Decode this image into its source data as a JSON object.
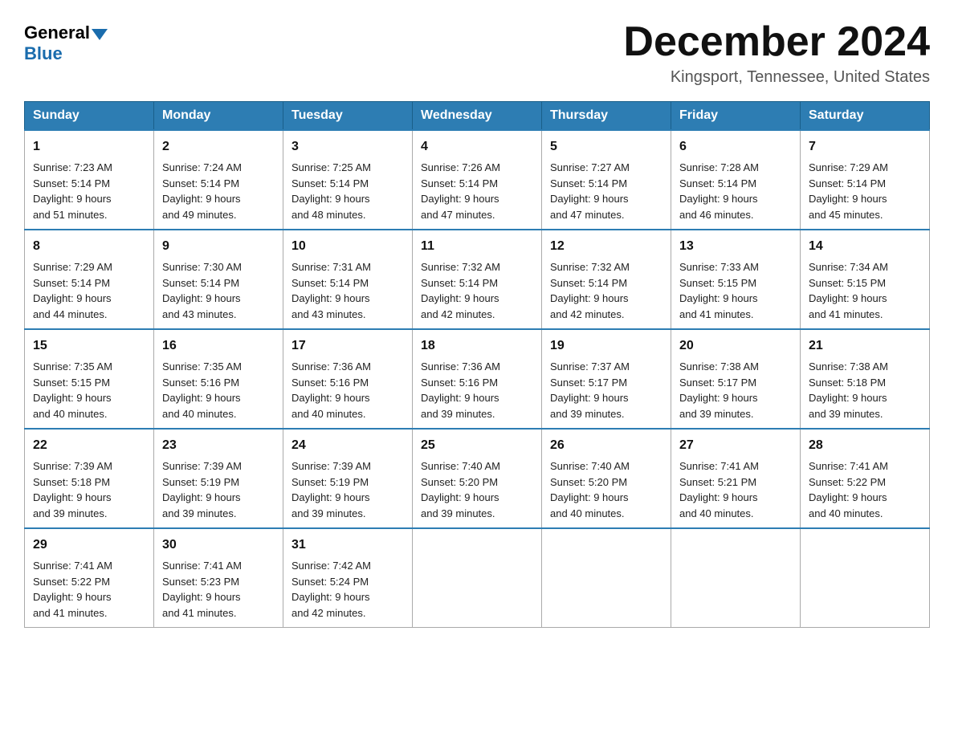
{
  "header": {
    "logo_general": "General",
    "logo_blue": "Blue",
    "month_title": "December 2024",
    "location": "Kingsport, Tennessee, United States"
  },
  "days_of_week": [
    "Sunday",
    "Monday",
    "Tuesday",
    "Wednesday",
    "Thursday",
    "Friday",
    "Saturday"
  ],
  "weeks": [
    [
      {
        "day": "1",
        "sunrise": "7:23 AM",
        "sunset": "5:14 PM",
        "daylight": "9 hours and 51 minutes."
      },
      {
        "day": "2",
        "sunrise": "7:24 AM",
        "sunset": "5:14 PM",
        "daylight": "9 hours and 49 minutes."
      },
      {
        "day": "3",
        "sunrise": "7:25 AM",
        "sunset": "5:14 PM",
        "daylight": "9 hours and 48 minutes."
      },
      {
        "day": "4",
        "sunrise": "7:26 AM",
        "sunset": "5:14 PM",
        "daylight": "9 hours and 47 minutes."
      },
      {
        "day": "5",
        "sunrise": "7:27 AM",
        "sunset": "5:14 PM",
        "daylight": "9 hours and 47 minutes."
      },
      {
        "day": "6",
        "sunrise": "7:28 AM",
        "sunset": "5:14 PM",
        "daylight": "9 hours and 46 minutes."
      },
      {
        "day": "7",
        "sunrise": "7:29 AM",
        "sunset": "5:14 PM",
        "daylight": "9 hours and 45 minutes."
      }
    ],
    [
      {
        "day": "8",
        "sunrise": "7:29 AM",
        "sunset": "5:14 PM",
        "daylight": "9 hours and 44 minutes."
      },
      {
        "day": "9",
        "sunrise": "7:30 AM",
        "sunset": "5:14 PM",
        "daylight": "9 hours and 43 minutes."
      },
      {
        "day": "10",
        "sunrise": "7:31 AM",
        "sunset": "5:14 PM",
        "daylight": "9 hours and 43 minutes."
      },
      {
        "day": "11",
        "sunrise": "7:32 AM",
        "sunset": "5:14 PM",
        "daylight": "9 hours and 42 minutes."
      },
      {
        "day": "12",
        "sunrise": "7:32 AM",
        "sunset": "5:14 PM",
        "daylight": "9 hours and 42 minutes."
      },
      {
        "day": "13",
        "sunrise": "7:33 AM",
        "sunset": "5:15 PM",
        "daylight": "9 hours and 41 minutes."
      },
      {
        "day": "14",
        "sunrise": "7:34 AM",
        "sunset": "5:15 PM",
        "daylight": "9 hours and 41 minutes."
      }
    ],
    [
      {
        "day": "15",
        "sunrise": "7:35 AM",
        "sunset": "5:15 PM",
        "daylight": "9 hours and 40 minutes."
      },
      {
        "day": "16",
        "sunrise": "7:35 AM",
        "sunset": "5:16 PM",
        "daylight": "9 hours and 40 minutes."
      },
      {
        "day": "17",
        "sunrise": "7:36 AM",
        "sunset": "5:16 PM",
        "daylight": "9 hours and 40 minutes."
      },
      {
        "day": "18",
        "sunrise": "7:36 AM",
        "sunset": "5:16 PM",
        "daylight": "9 hours and 39 minutes."
      },
      {
        "day": "19",
        "sunrise": "7:37 AM",
        "sunset": "5:17 PM",
        "daylight": "9 hours and 39 minutes."
      },
      {
        "day": "20",
        "sunrise": "7:38 AM",
        "sunset": "5:17 PM",
        "daylight": "9 hours and 39 minutes."
      },
      {
        "day": "21",
        "sunrise": "7:38 AM",
        "sunset": "5:18 PM",
        "daylight": "9 hours and 39 minutes."
      }
    ],
    [
      {
        "day": "22",
        "sunrise": "7:39 AM",
        "sunset": "5:18 PM",
        "daylight": "9 hours and 39 minutes."
      },
      {
        "day": "23",
        "sunrise": "7:39 AM",
        "sunset": "5:19 PM",
        "daylight": "9 hours and 39 minutes."
      },
      {
        "day": "24",
        "sunrise": "7:39 AM",
        "sunset": "5:19 PM",
        "daylight": "9 hours and 39 minutes."
      },
      {
        "day": "25",
        "sunrise": "7:40 AM",
        "sunset": "5:20 PM",
        "daylight": "9 hours and 39 minutes."
      },
      {
        "day": "26",
        "sunrise": "7:40 AM",
        "sunset": "5:20 PM",
        "daylight": "9 hours and 40 minutes."
      },
      {
        "day": "27",
        "sunrise": "7:41 AM",
        "sunset": "5:21 PM",
        "daylight": "9 hours and 40 minutes."
      },
      {
        "day": "28",
        "sunrise": "7:41 AM",
        "sunset": "5:22 PM",
        "daylight": "9 hours and 40 minutes."
      }
    ],
    [
      {
        "day": "29",
        "sunrise": "7:41 AM",
        "sunset": "5:22 PM",
        "daylight": "9 hours and 41 minutes."
      },
      {
        "day": "30",
        "sunrise": "7:41 AM",
        "sunset": "5:23 PM",
        "daylight": "9 hours and 41 minutes."
      },
      {
        "day": "31",
        "sunrise": "7:42 AM",
        "sunset": "5:24 PM",
        "daylight": "9 hours and 42 minutes."
      },
      null,
      null,
      null,
      null
    ]
  ],
  "labels": {
    "sunrise_prefix": "Sunrise: ",
    "sunset_prefix": "Sunset: ",
    "daylight_prefix": "Daylight: "
  }
}
